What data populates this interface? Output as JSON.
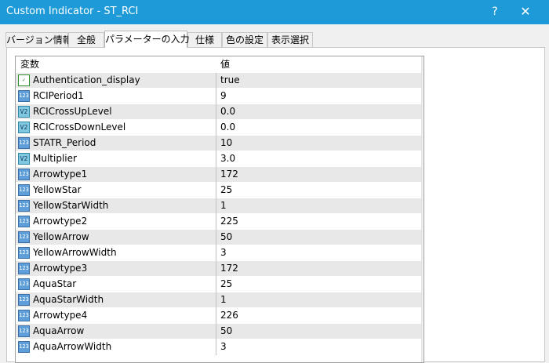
{
  "window": {
    "title": "Custom Indicator - ST_RCI",
    "help_label": "?",
    "close_label": "✕"
  },
  "tabs": [
    {
      "label": "バージョン情報"
    },
    {
      "label": "全般"
    },
    {
      "label": "パラメーターの入力"
    },
    {
      "label": "仕様"
    },
    {
      "label": "色の設定"
    },
    {
      "label": "表示選択"
    }
  ],
  "grid": {
    "headers": {
      "variable": "変数",
      "value": "値"
    },
    "icons": {
      "int": "123",
      "double": "V2",
      "bool": "✓"
    },
    "rows": [
      {
        "name": "Authentication_display",
        "value": "true",
        "icon": "bool"
      },
      {
        "name": "RCIPeriod1",
        "value": "9",
        "icon": "int"
      },
      {
        "name": "RCICrossUpLevel",
        "value": "0.0",
        "icon": "double"
      },
      {
        "name": "RCICrossDownLevel",
        "value": "0.0",
        "icon": "double"
      },
      {
        "name": "STATR_Period",
        "value": "10",
        "icon": "int"
      },
      {
        "name": "Multiplier",
        "value": "3.0",
        "icon": "double"
      },
      {
        "name": "Arrowtype1",
        "value": "172",
        "icon": "int"
      },
      {
        "name": "YellowStar",
        "value": "25",
        "icon": "int"
      },
      {
        "name": "YellowStarWidth",
        "value": "1",
        "icon": "int"
      },
      {
        "name": "Arrowtype2",
        "value": "225",
        "icon": "int"
      },
      {
        "name": "YellowArrow",
        "value": "50",
        "icon": "int"
      },
      {
        "name": "YellowArrowWidth",
        "value": "3",
        "icon": "int"
      },
      {
        "name": "Arrowtype3",
        "value": "172",
        "icon": "int"
      },
      {
        "name": "AquaStar",
        "value": "25",
        "icon": "int"
      },
      {
        "name": "AquaStarWidth",
        "value": "1",
        "icon": "int"
      },
      {
        "name": "Arrowtype4",
        "value": "226",
        "icon": "int"
      },
      {
        "name": "AquaArrow",
        "value": "50",
        "icon": "int"
      },
      {
        "name": "AquaArrowWidth",
        "value": "3",
        "icon": "int"
      }
    ]
  },
  "scrollbar": {
    "up_arrow": "▲"
  },
  "colors": {
    "titlebar": "#1e9ad8",
    "row_alt": "#e8e8e8"
  }
}
